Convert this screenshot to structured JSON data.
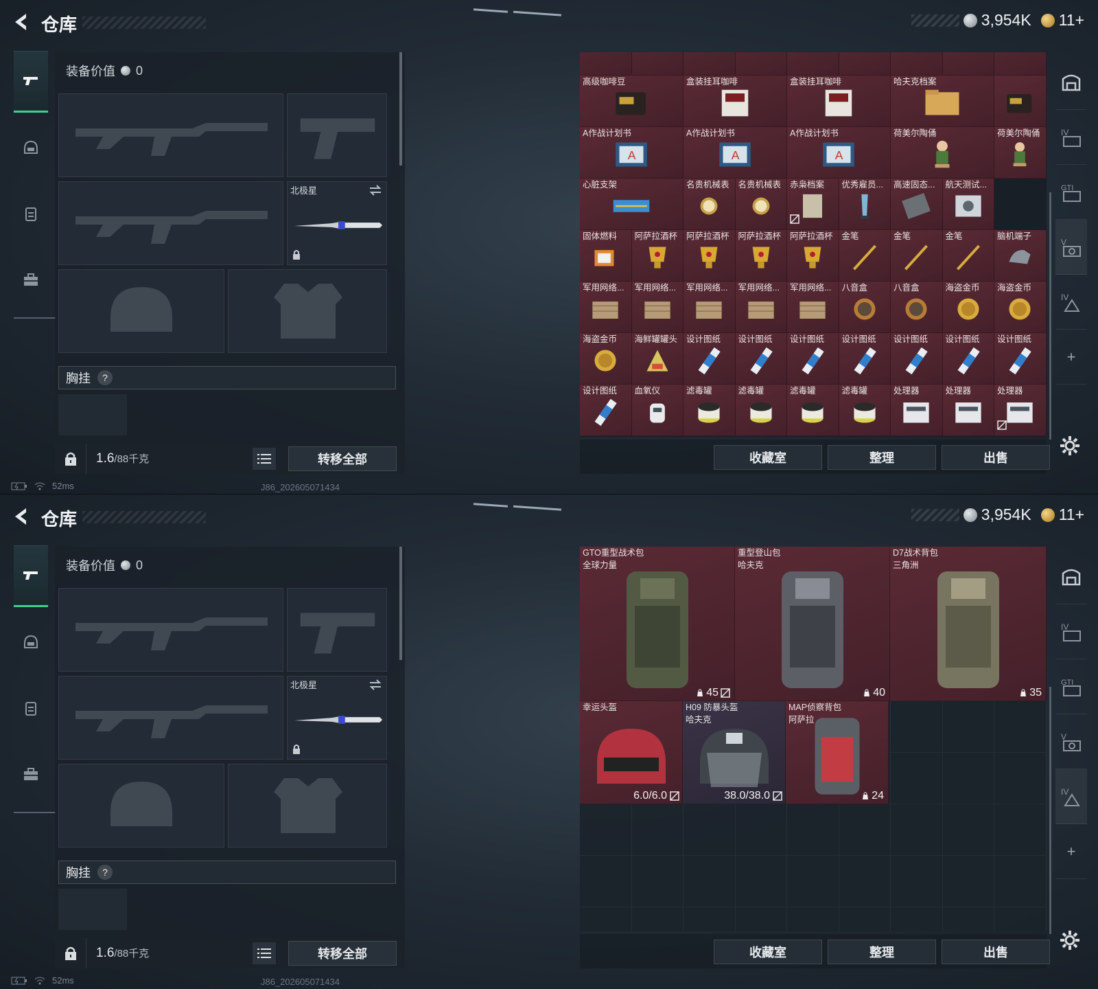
{
  "header": {
    "title": "仓库",
    "silver_amount": "3,954K",
    "gold_amount": "11+"
  },
  "loadout": {
    "equip_value_label": "装备价值",
    "equip_value": "0",
    "melee_name": "北极星",
    "chest_label": "胸挂",
    "chest_help": "?",
    "weight_current": "1.6",
    "weight_max": "/88千克",
    "transfer_all": "转移全部"
  },
  "status": {
    "ping": "52ms",
    "build_id": "J86_202605071434"
  },
  "buttons": {
    "collection": "收藏室",
    "organize": "整理",
    "sell": "出售"
  },
  "colors": {
    "gold_rarity": "#5a2a34",
    "purple_rarity": "#3b3347",
    "active_tab": "#3fd08c"
  },
  "right_tabs": [
    "vault-icon",
    "tab-iv-icon",
    "tab-gti-icon",
    "tab-v-icon",
    "tab-iv-alt-icon"
  ],
  "stash1": {
    "items": [
      {
        "name": "高级咖啡豆",
        "art": "coffee-bag",
        "rarity": "gold"
      },
      {
        "name": "盒装挂耳咖啡",
        "art": "coffee-box",
        "rarity": "gold"
      },
      {
        "name": "盒装挂耳咖啡",
        "art": "coffee-box",
        "rarity": "gold"
      },
      {
        "name": "哈夫克档案",
        "art": "folder",
        "rarity": "gold"
      },
      {
        "name": "A作战计划书",
        "art": "plan",
        "rarity": "gold"
      },
      {
        "name": "A作战计划书",
        "art": "plan",
        "rarity": "gold"
      },
      {
        "name": "A作战计划书",
        "art": "plan",
        "rarity": "gold"
      },
      {
        "name": "荷美尔陶俑",
        "art": "figurine",
        "rarity": "gold"
      },
      {
        "name": "荷美尔陶俑",
        "art": "figurine",
        "rarity": "gold"
      },
      {
        "name": "心脏支架",
        "art": "stent",
        "rarity": "gold"
      },
      {
        "name": "名贵机械表",
        "art": "watch",
        "rarity": "gold"
      },
      {
        "name": "名贵机械表",
        "art": "watch",
        "rarity": "gold"
      },
      {
        "name": "赤枭档案",
        "art": "paper",
        "rarity": "gold"
      },
      {
        "name": "优秀雇员...",
        "art": "trophy",
        "rarity": "gold"
      },
      {
        "name": "高速固态...",
        "art": "ssd",
        "rarity": "gold"
      },
      {
        "name": "航天测试...",
        "art": "device",
        "rarity": "gold"
      },
      {
        "name": "固体燃料",
        "art": "fuel",
        "rarity": "gold"
      },
      {
        "name": "阿萨拉酒杯",
        "art": "cup",
        "rarity": "gold"
      },
      {
        "name": "阿萨拉酒杯",
        "art": "cup",
        "rarity": "gold"
      },
      {
        "name": "阿萨拉酒杯",
        "art": "cup",
        "rarity": "gold"
      },
      {
        "name": "阿萨拉酒杯",
        "art": "cup",
        "rarity": "gold"
      },
      {
        "name": "金笔",
        "art": "pen",
        "rarity": "gold"
      },
      {
        "name": "金笔",
        "art": "pen",
        "rarity": "gold"
      },
      {
        "name": "金笔",
        "art": "pen",
        "rarity": "gold"
      },
      {
        "name": "脑机端子",
        "art": "chip",
        "rarity": "gold"
      },
      {
        "name": "军用网络...",
        "art": "crate",
        "rarity": "gold"
      },
      {
        "name": "军用网络...",
        "art": "crate",
        "rarity": "gold"
      },
      {
        "name": "军用网络...",
        "art": "crate",
        "rarity": "gold"
      },
      {
        "name": "军用网络...",
        "art": "crate",
        "rarity": "gold"
      },
      {
        "name": "军用网络...",
        "art": "crate",
        "rarity": "gold"
      },
      {
        "name": "八音盒",
        "art": "musicbox",
        "rarity": "gold"
      },
      {
        "name": "八音盒",
        "art": "musicbox",
        "rarity": "gold"
      },
      {
        "name": "海盗金币",
        "art": "coin",
        "rarity": "gold"
      },
      {
        "name": "海盗金币",
        "art": "coin",
        "rarity": "gold"
      },
      {
        "name": "海盗金币",
        "art": "coin",
        "rarity": "gold"
      },
      {
        "name": "海鲜罐罐头",
        "art": "can",
        "rarity": "gold"
      },
      {
        "name": "设计图纸",
        "art": "blueprint",
        "rarity": "gold"
      },
      {
        "name": "设计图纸",
        "art": "blueprint",
        "rarity": "gold"
      },
      {
        "name": "设计图纸",
        "art": "blueprint",
        "rarity": "gold"
      },
      {
        "name": "设计图纸",
        "art": "blueprint",
        "rarity": "gold"
      },
      {
        "name": "设计图纸",
        "art": "blueprint",
        "rarity": "gold"
      },
      {
        "name": "设计图纸",
        "art": "blueprint",
        "rarity": "gold"
      },
      {
        "name": "设计图纸",
        "art": "blueprint",
        "rarity": "gold"
      },
      {
        "name": "设计图纸",
        "art": "blueprint",
        "rarity": "gold"
      },
      {
        "name": "血氧仪",
        "art": "oximeter",
        "rarity": "gold"
      },
      {
        "name": "滤毒罐",
        "art": "filter",
        "rarity": "gold"
      },
      {
        "name": "滤毒罐",
        "art": "filter",
        "rarity": "gold"
      },
      {
        "name": "滤毒罐",
        "art": "filter",
        "rarity": "gold"
      },
      {
        "name": "滤毒罐",
        "art": "filter",
        "rarity": "gold"
      },
      {
        "name": "处理器",
        "art": "cpu",
        "rarity": "gold"
      },
      {
        "name": "处理器",
        "art": "cpu",
        "rarity": "gold"
      },
      {
        "name": "处理器",
        "art": "cpu",
        "rarity": "gold"
      }
    ]
  },
  "stash2": {
    "items": [
      {
        "name": "GTO重型战术包",
        "sub": "全球力量",
        "count": "45",
        "art": "backpack-green",
        "rarity": "gold"
      },
      {
        "name": "重型登山包",
        "sub": "哈夫克",
        "count": "40",
        "art": "backpack-grey",
        "rarity": "gold"
      },
      {
        "name": "D7战术背包",
        "sub": "三角洲",
        "count": "35",
        "art": "backpack-tan",
        "rarity": "gold"
      },
      {
        "name": "幸运头盔",
        "sub": "",
        "durability": "6.0/6.0",
        "art": "helmet-red",
        "rarity": "gold"
      },
      {
        "name": "H09 防暴头盔",
        "sub": "哈夫克",
        "durability": "38.0/38.0",
        "art": "helmet-riot",
        "rarity": "purple"
      },
      {
        "name": "MAP侦察背包",
        "sub": "阿萨拉",
        "count": "24",
        "art": "backpack-recon",
        "rarity": "gold"
      }
    ]
  }
}
